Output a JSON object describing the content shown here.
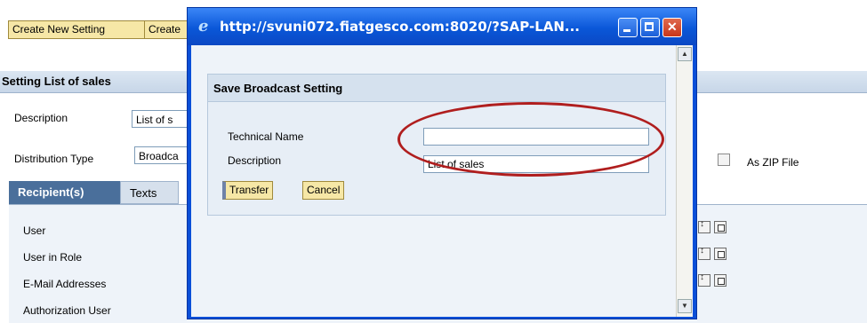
{
  "toolbar": {
    "create_new_setting": "Create New Setting",
    "create_truncated": "Create"
  },
  "section": {
    "title": "Setting List of sales"
  },
  "form": {
    "description_label": "Description",
    "description_value": "List of s",
    "distribution_type_label": "Distribution Type",
    "distribution_type_value": "Broadca",
    "as_zip_label": "As ZIP File"
  },
  "tabs": [
    {
      "label": "Recipient(s)",
      "active": true
    },
    {
      "label": "Texts",
      "active": false
    }
  ],
  "recipient_rows": [
    "User",
    "User in Role",
    "E-Mail Addresses",
    "Authorization User"
  ],
  "popup": {
    "window_title": "http://svuni072.fiatgesco.com:8020/?SAP-LAN...",
    "dialog_title": "Save Broadcast Setting",
    "technical_name_label": "Technical Name",
    "technical_name_value": "",
    "description_label": "Description",
    "description_value": "List of sales",
    "transfer_button": "Transfer",
    "cancel_button": "Cancel"
  },
  "colors": {
    "sap_button_bg": "#f6e7a6",
    "highlight_ellipse": "#b01e1e",
    "active_tab": "#4a6f9b",
    "xp_titlebar": "#0a57d8"
  },
  "icons": [
    "ie-icon",
    "minimize-icon",
    "maximize-icon",
    "close-icon",
    "scroll-up-icon",
    "scroll-down-icon",
    "value-help-icon",
    "multi-select-icon"
  ]
}
